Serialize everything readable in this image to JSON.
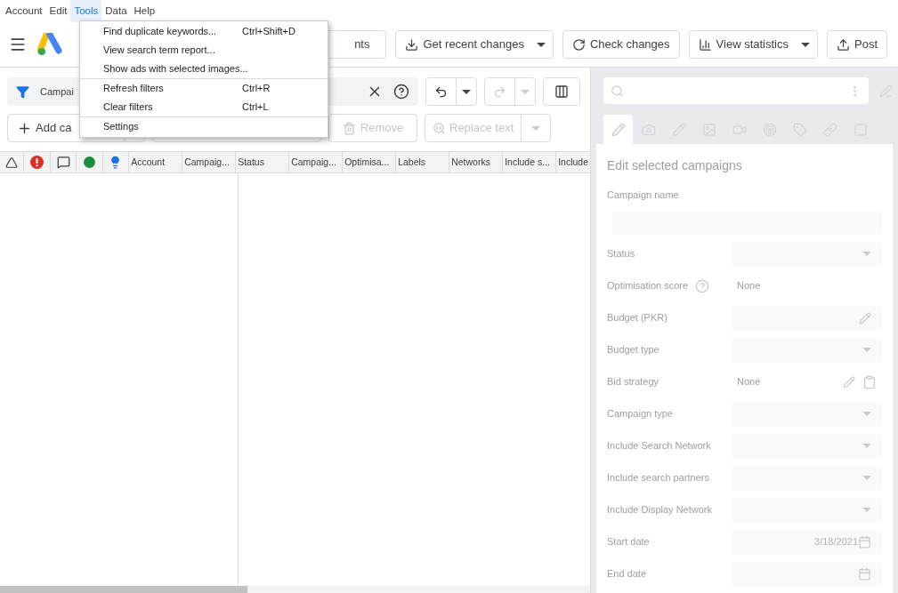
{
  "menu_bar": [
    {
      "label": "Account",
      "selected": false
    },
    {
      "label": "Edit",
      "selected": false
    },
    {
      "label": "Tools",
      "selected": true
    },
    {
      "label": "Data",
      "selected": false
    },
    {
      "label": "Help",
      "selected": false
    }
  ],
  "tools_menu": {
    "groups": [
      [
        {
          "label": "Find duplicate keywords...",
          "shortcut": "Ctrl+Shift+D"
        },
        {
          "label": "View search term report..."
        },
        {
          "label": "Show ads with selected images..."
        }
      ],
      [
        {
          "label": "Refresh filters",
          "shortcut": "Ctrl+R"
        },
        {
          "label": "Clear filters",
          "shortcut": "Ctrl+L"
        }
      ],
      [
        {
          "label": "Settings"
        }
      ]
    ]
  },
  "header": {
    "hidden_button_fragment": "nts",
    "buttons": [
      {
        "label": "Get recent changes",
        "kind": "download",
        "split": true
      },
      {
        "label": "Check changes",
        "kind": "refresh",
        "split": false
      },
      {
        "label": "View statistics",
        "kind": "stats",
        "split": true
      },
      {
        "label": "Post",
        "kind": "upload",
        "split": false
      }
    ]
  },
  "filter": {
    "label": "Campai"
  },
  "toolbar": {
    "undo_disabled": false,
    "redo_disabled": true,
    "add_label": "Add ca",
    "remove": {
      "label": "Remove",
      "disabled": true
    },
    "replace": {
      "label": "Replace text",
      "disabled": true
    }
  },
  "table": {
    "columns": [
      "Account",
      "Campaig...",
      "Status",
      "Campaig...",
      "Optimisa...",
      "Labels",
      "Networks",
      "Include s...",
      "Include"
    ]
  },
  "edit_panel": {
    "title": "Edit selected campaigns",
    "fields": [
      {
        "label": "Campaign name",
        "kind": "wide"
      },
      {
        "label": "Status",
        "kind": "select"
      },
      {
        "label": "Optimisation score",
        "kind": "static",
        "value": "None",
        "help": true
      },
      {
        "label": "Budget (PKR)",
        "kind": "edit"
      },
      {
        "label": "Budget type",
        "kind": "select"
      },
      {
        "label": "Bid strategy",
        "kind": "static",
        "value": "None",
        "edit": true
      },
      {
        "label": "Campaign type",
        "kind": "select"
      },
      {
        "label": "Include Search Network",
        "kind": "select"
      },
      {
        "label": "Include search partners",
        "kind": "select"
      },
      {
        "label": "Include Display Network",
        "kind": "select"
      },
      {
        "label": "Start date",
        "kind": "date",
        "value": "3/18/2021"
      },
      {
        "label": "End date",
        "kind": "date"
      }
    ]
  }
}
